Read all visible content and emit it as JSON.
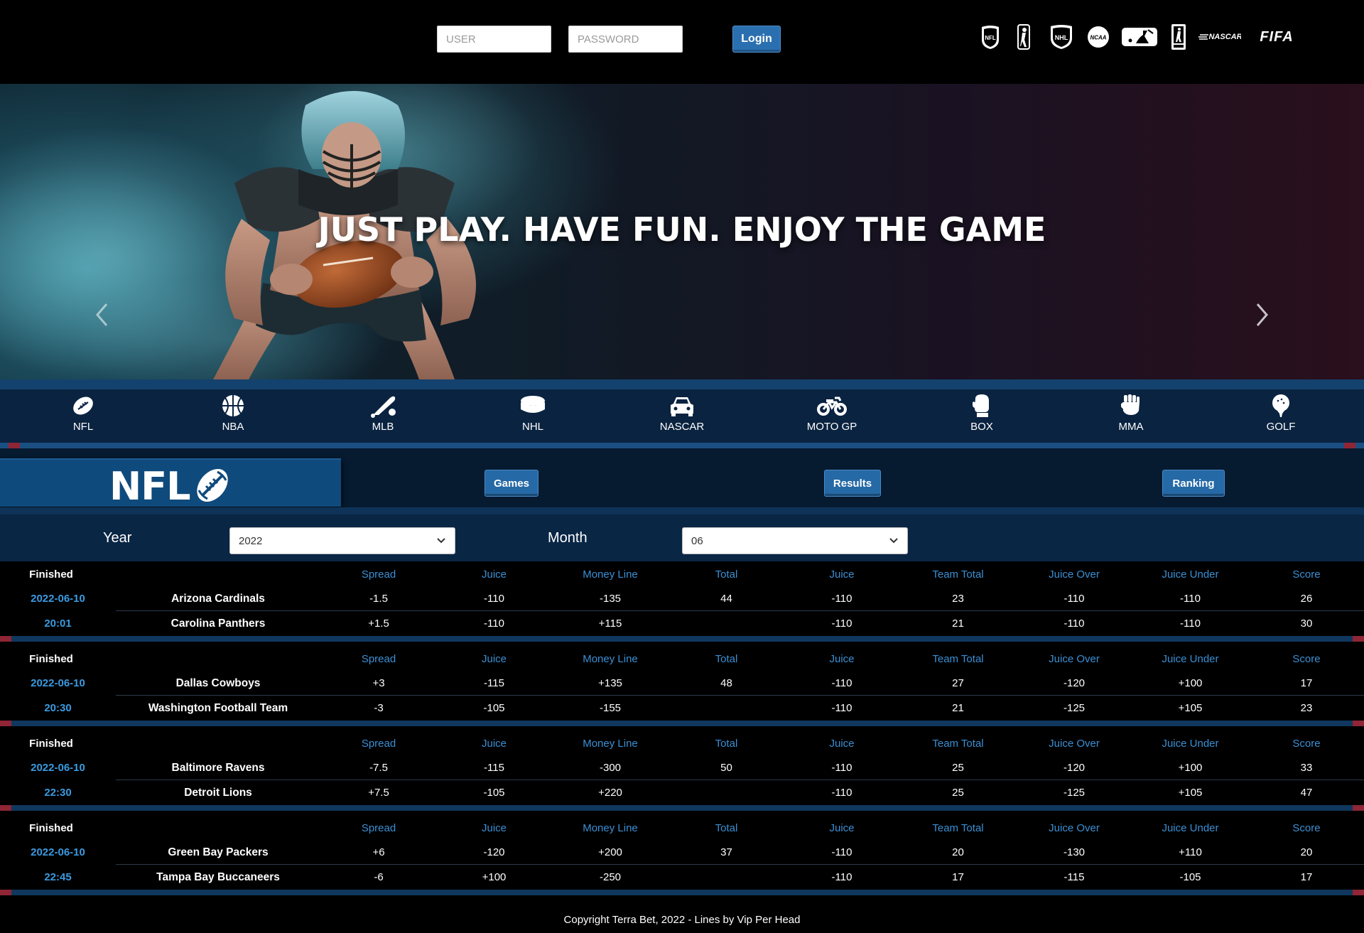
{
  "header": {
    "user_placeholder": "USER",
    "password_placeholder": "PASSWORD",
    "login_label": "Login",
    "league_logos": [
      {
        "name": "nfl-logo",
        "text": "NFL"
      },
      {
        "name": "nba-logo",
        "text": ""
      },
      {
        "name": "nhl-logo",
        "text": "NHL"
      },
      {
        "name": "ncaa-logo",
        "text": "NCAA"
      },
      {
        "name": "mlb-logo",
        "text": ""
      },
      {
        "name": "pga-tour-logo",
        "text": ""
      },
      {
        "name": "nascar-logo",
        "text": "NASCAR"
      },
      {
        "name": "fifa-logo",
        "text": "FIFA"
      }
    ]
  },
  "hero": {
    "headline": "JUST PLAY. HAVE FUN. ENJOY THE GAME"
  },
  "sports_nav": [
    {
      "label": "NFL",
      "icon": "football-icon"
    },
    {
      "label": "NBA",
      "icon": "basketball-icon"
    },
    {
      "label": "MLB",
      "icon": "baseball-bat-icon"
    },
    {
      "label": "NHL",
      "icon": "hockey-puck-icon"
    },
    {
      "label": "NASCAR",
      "icon": "car-icon"
    },
    {
      "label": "MOTO GP",
      "icon": "motorcycle-icon"
    },
    {
      "label": "BOX",
      "icon": "boxing-glove-icon"
    },
    {
      "label": "MMA",
      "icon": "fist-icon"
    },
    {
      "label": "GOLF",
      "icon": "golf-ball-icon"
    }
  ],
  "league": {
    "title": "NFL",
    "tabs": {
      "games": "Games",
      "results": "Results",
      "ranking": "Ranking"
    }
  },
  "filters": {
    "year_label": "Year",
    "year_value": "2022",
    "month_label": "Month",
    "month_value": "06"
  },
  "columns": [
    "Spread",
    "Juice",
    "Money Line",
    "Total",
    "Juice",
    "Team Total",
    "Juice Over",
    "Juice Under",
    "Score"
  ],
  "games": [
    {
      "status": "Finished",
      "date": "2022-06-10",
      "time": "20:01",
      "teams": [
        {
          "name": "Arizona Cardinals",
          "spread": "-1.5",
          "juice": "-110",
          "money_line": "-135",
          "total": "44",
          "total_juice": "-110",
          "team_total": "23",
          "juice_over": "-110",
          "juice_under": "-110",
          "score": "26"
        },
        {
          "name": "Carolina Panthers",
          "spread": "+1.5",
          "juice": "-110",
          "money_line": "+115",
          "total": "",
          "total_juice": "-110",
          "team_total": "21",
          "juice_over": "-110",
          "juice_under": "-110",
          "score": "30"
        }
      ]
    },
    {
      "status": "Finished",
      "date": "2022-06-10",
      "time": "20:30",
      "teams": [
        {
          "name": "Dallas Cowboys",
          "spread": "+3",
          "juice": "-115",
          "money_line": "+135",
          "total": "48",
          "total_juice": "-110",
          "team_total": "27",
          "juice_over": "-120",
          "juice_under": "+100",
          "score": "17"
        },
        {
          "name": "Washington Football Team",
          "spread": "-3",
          "juice": "-105",
          "money_line": "-155",
          "total": "",
          "total_juice": "-110",
          "team_total": "21",
          "juice_over": "-125",
          "juice_under": "+105",
          "score": "23"
        }
      ]
    },
    {
      "status": "Finished",
      "date": "2022-06-10",
      "time": "22:30",
      "teams": [
        {
          "name": "Baltimore Ravens",
          "spread": "-7.5",
          "juice": "-115",
          "money_line": "-300",
          "total": "50",
          "total_juice": "-110",
          "team_total": "25",
          "juice_over": "-120",
          "juice_under": "+100",
          "score": "33"
        },
        {
          "name": "Detroit Lions",
          "spread": "+7.5",
          "juice": "-105",
          "money_line": "+220",
          "total": "",
          "total_juice": "-110",
          "team_total": "25",
          "juice_over": "-125",
          "juice_under": "+105",
          "score": "47"
        }
      ]
    },
    {
      "status": "Finished",
      "date": "2022-06-10",
      "time": "22:45",
      "teams": [
        {
          "name": "Green Bay Packers",
          "spread": "+6",
          "juice": "-120",
          "money_line": "+200",
          "total": "37",
          "total_juice": "-110",
          "team_total": "20",
          "juice_over": "-130",
          "juice_under": "+110",
          "score": "20"
        },
        {
          "name": "Tampa Bay Buccaneers",
          "spread": "-6",
          "juice": "+100",
          "money_line": "-250",
          "total": "",
          "total_juice": "-110",
          "team_total": "17",
          "juice_over": "-115",
          "juice_under": "-105",
          "score": "17"
        }
      ]
    }
  ],
  "footer": {
    "copyright": "Copyright Terra Bet, 2022 - Lines by Vip Per Head"
  }
}
